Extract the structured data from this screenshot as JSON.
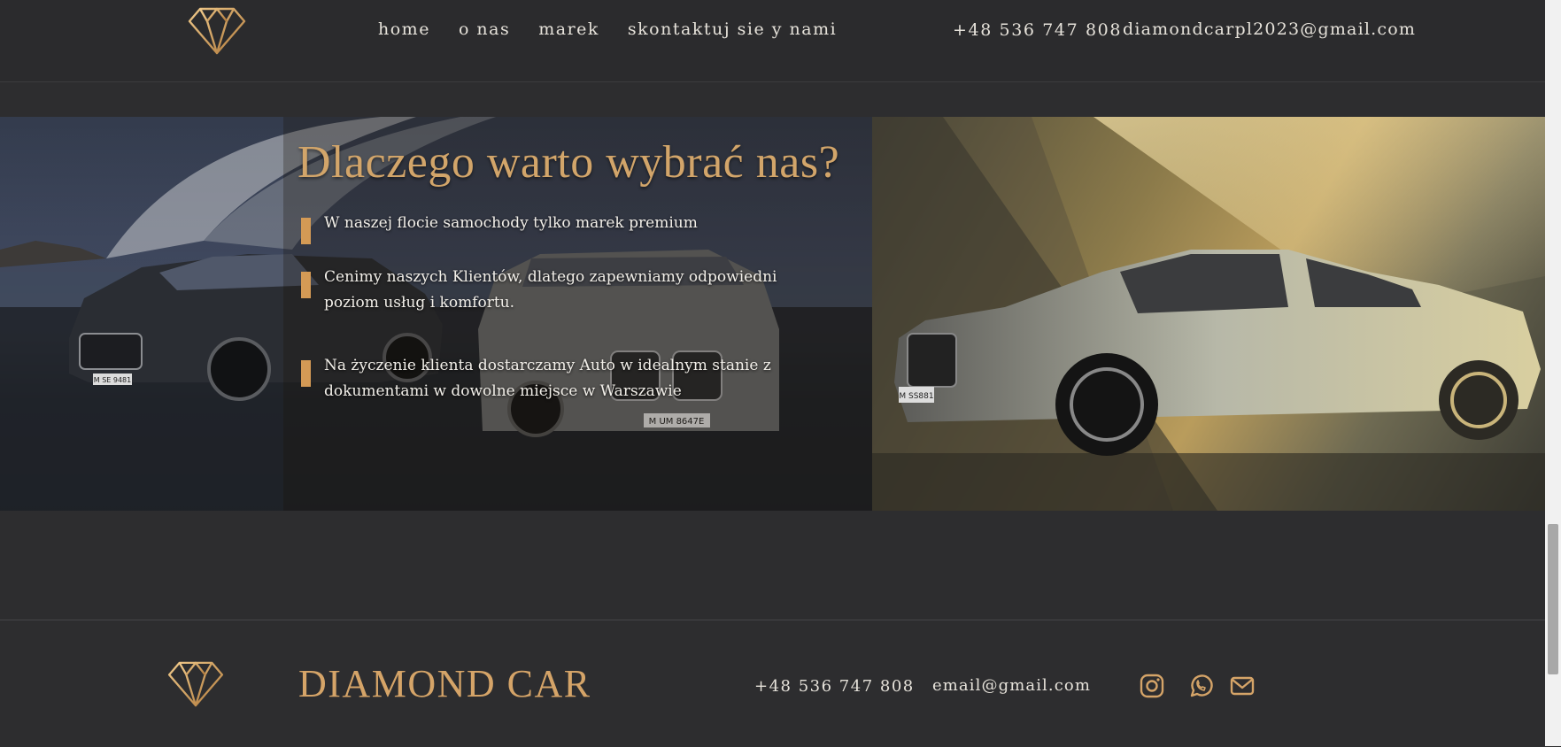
{
  "header": {
    "nav": [
      "home",
      "o nas",
      "marek",
      "skontaktuj sie y nami"
    ],
    "phone": "+48 536 747 808",
    "email": "diamondcarpl2023@gmail.com"
  },
  "hero": {
    "title": "Dlaczego warto wybrać nas?",
    "reasons": [
      "W naszej flocie samochody tylko marek premium",
      "Cenimy naszych Klientów, dlatego zapewniamy odpowiedni poziom usług i komfortu.",
      "Na życzenie klienta dostarczamy Auto w idealnym stanie z dokumentami w dowolne miejsce w Warszawie"
    ],
    "plates": {
      "left_car": "M SE 9481",
      "middle_car": "M UM 8647E",
      "right_car": "M SS881"
    }
  },
  "footer": {
    "brand": "DIAMOND CAR",
    "phone": "+48 536 747 808",
    "email": "email@gmail.com",
    "social_icons": [
      "instagram-icon",
      "whatsapp-icon",
      "mail-icon"
    ]
  },
  "colors": {
    "accent_gold": "#d2a56a",
    "bar_gold": "#d49a55",
    "background": "#2d2d2f",
    "text_light": "#e6e2da"
  }
}
